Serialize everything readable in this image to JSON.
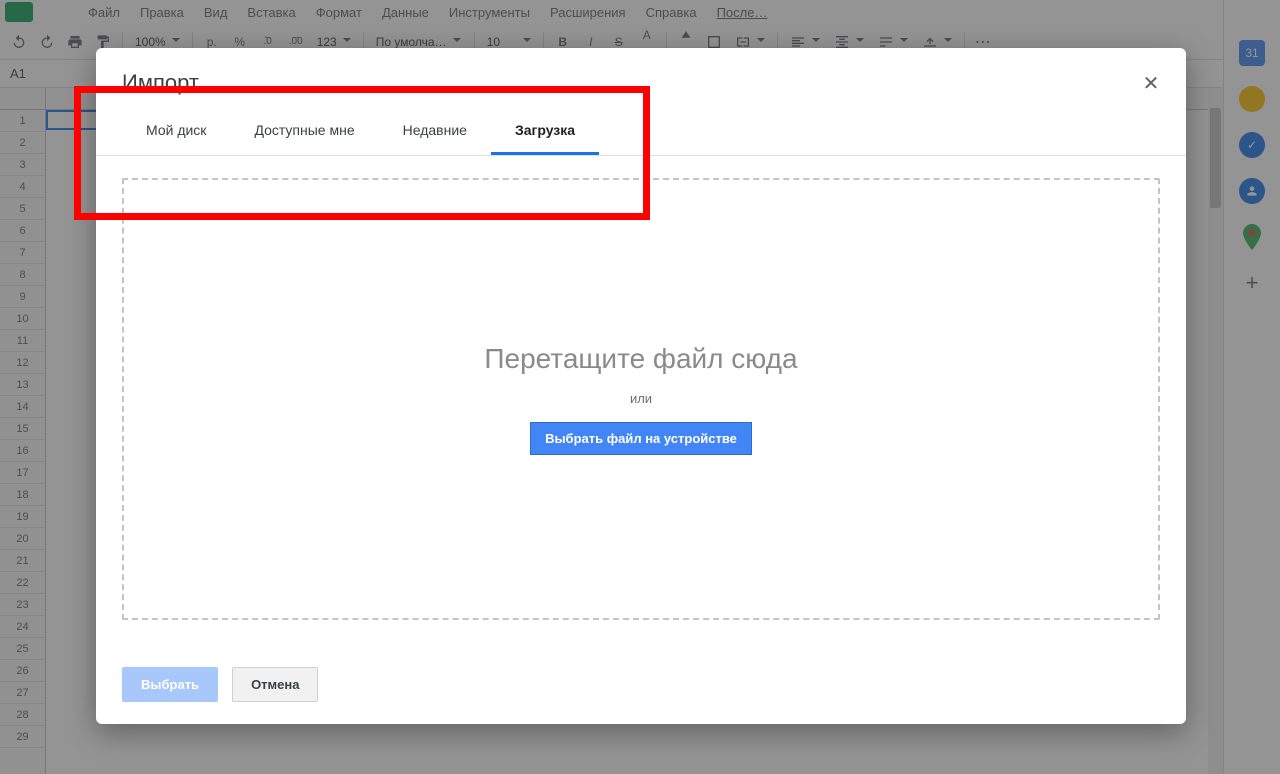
{
  "menubar": {
    "items": [
      "Файл",
      "Правка",
      "Вид",
      "Вставка",
      "Формат",
      "Данные",
      "Инструменты",
      "Расширения",
      "Справка"
    ],
    "lastEdit": "После…"
  },
  "toolbar": {
    "zoom": "100%",
    "currency": "р.",
    "percent": "%",
    "decDecrease": ".0",
    "decIncrease": ".00",
    "numFormat": "123",
    "font": "По умолча…",
    "fontSize": "10",
    "more": "⋯"
  },
  "namebox": {
    "ref": "A1"
  },
  "rows": [
    "1",
    "2",
    "3",
    "4",
    "5",
    "6",
    "7",
    "8",
    "9",
    "10",
    "11",
    "12",
    "13",
    "14",
    "15",
    "16",
    "17",
    "18",
    "19",
    "20",
    "21",
    "22",
    "23",
    "24",
    "25",
    "26",
    "27",
    "28",
    "29"
  ],
  "sidepanel": {
    "calendar": {
      "text": "31",
      "bg": "#4285f4"
    },
    "keep": {
      "bg": "#fbbc04"
    },
    "tasks": {
      "bg": "#1a73e8"
    },
    "contacts": {
      "bg": "#1a73e8"
    },
    "maps": {
      "bg": "#34a853"
    }
  },
  "dialog": {
    "title": "Импорт",
    "tabs": [
      "Мой диск",
      "Доступные мне",
      "Недавние",
      "Загрузка"
    ],
    "activeTab": 3,
    "dropzone": {
      "heading": "Перетащите файл сюда",
      "or": "или",
      "browse": "Выбрать файл на устройстве"
    },
    "actions": {
      "select": "Выбрать",
      "cancel": "Отмена"
    }
  }
}
